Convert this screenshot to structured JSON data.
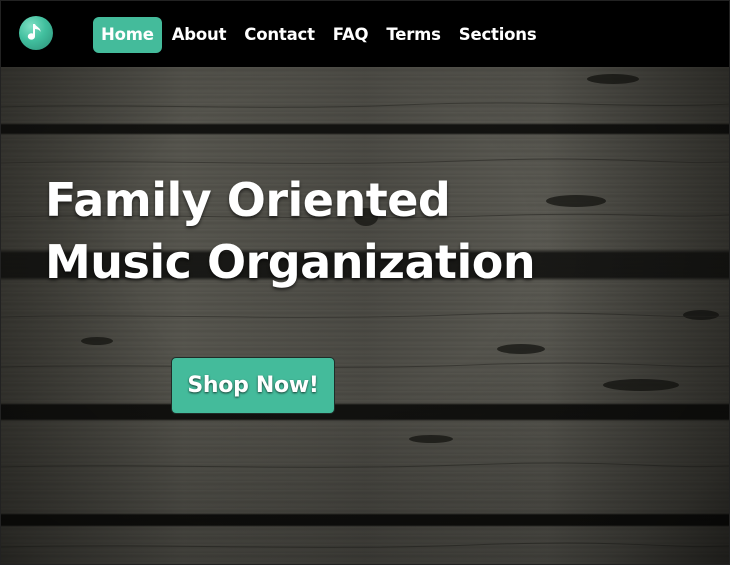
{
  "brand": {
    "logo_icon": "music-note-icon",
    "logo_color": "#44bb9b"
  },
  "nav": {
    "items": [
      {
        "label": "Home",
        "active": true
      },
      {
        "label": "About",
        "active": false
      },
      {
        "label": "Contact",
        "active": false
      },
      {
        "label": "FAQ",
        "active": false
      },
      {
        "label": "Terms",
        "active": false
      },
      {
        "label": "Sections",
        "active": false
      }
    ]
  },
  "hero": {
    "title_line1": "Family Oriented",
    "title_line2": "Music Organization",
    "cta_label": "Shop Now!",
    "background": "dark-wood-planks"
  },
  "colors": {
    "accent": "#44bb9b",
    "navbar": "#000000",
    "text": "#ffffff"
  }
}
